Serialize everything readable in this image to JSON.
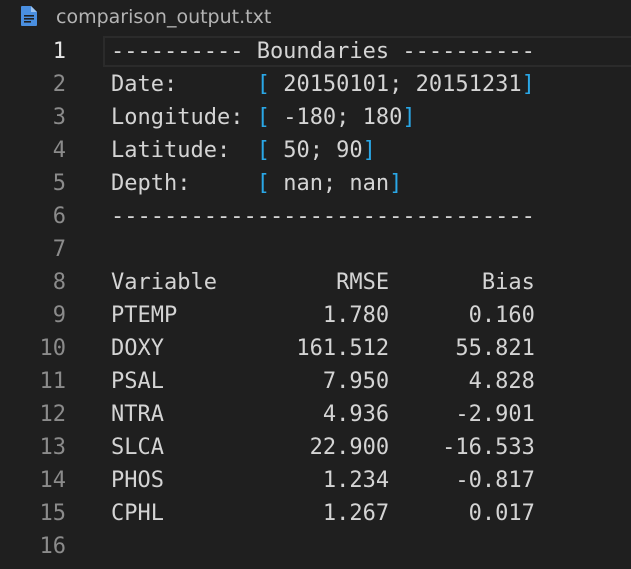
{
  "tab": {
    "icon": "text-file-icon",
    "filename": "comparison_output.txt"
  },
  "editor": {
    "active_line": 1,
    "line_numbers": [
      "1",
      "2",
      "3",
      "4",
      "5",
      "6",
      "7",
      "8",
      "9",
      "10",
      "11",
      "12",
      "13",
      "14",
      "15",
      "16"
    ],
    "boundaries": {
      "header": "---------- Boundaries ----------",
      "date_label": "Date:      ",
      "date_value": " 20150101; 20151231",
      "lon_label": "Longitude: ",
      "lon_value": " -180; 180",
      "lat_label": "Latitude:  ",
      "lat_value": " 50; 90",
      "depth_label": "Depth:     ",
      "depth_value": " nan; nan",
      "footer": "--------------------------------",
      "open_bracket": "[",
      "close_bracket": "]"
    },
    "table": {
      "header": "Variable         RMSE       Bias",
      "rows": [
        "PTEMP           1.780      0.160",
        "DOXY          161.512     55.821",
        "PSAL            7.950      4.828",
        "NTRA            4.936     -2.901",
        "SLCA           22.900    -16.533",
        "PHOS            1.234     -0.817",
        "CPHL            1.267      0.017"
      ]
    }
  },
  "colors": {
    "background": "#1f1f1f",
    "text": "#d4d4d4",
    "bracket": "#2aa7e6",
    "gutter": "#8b8b8b",
    "file_icon": "#4a8fe0"
  }
}
